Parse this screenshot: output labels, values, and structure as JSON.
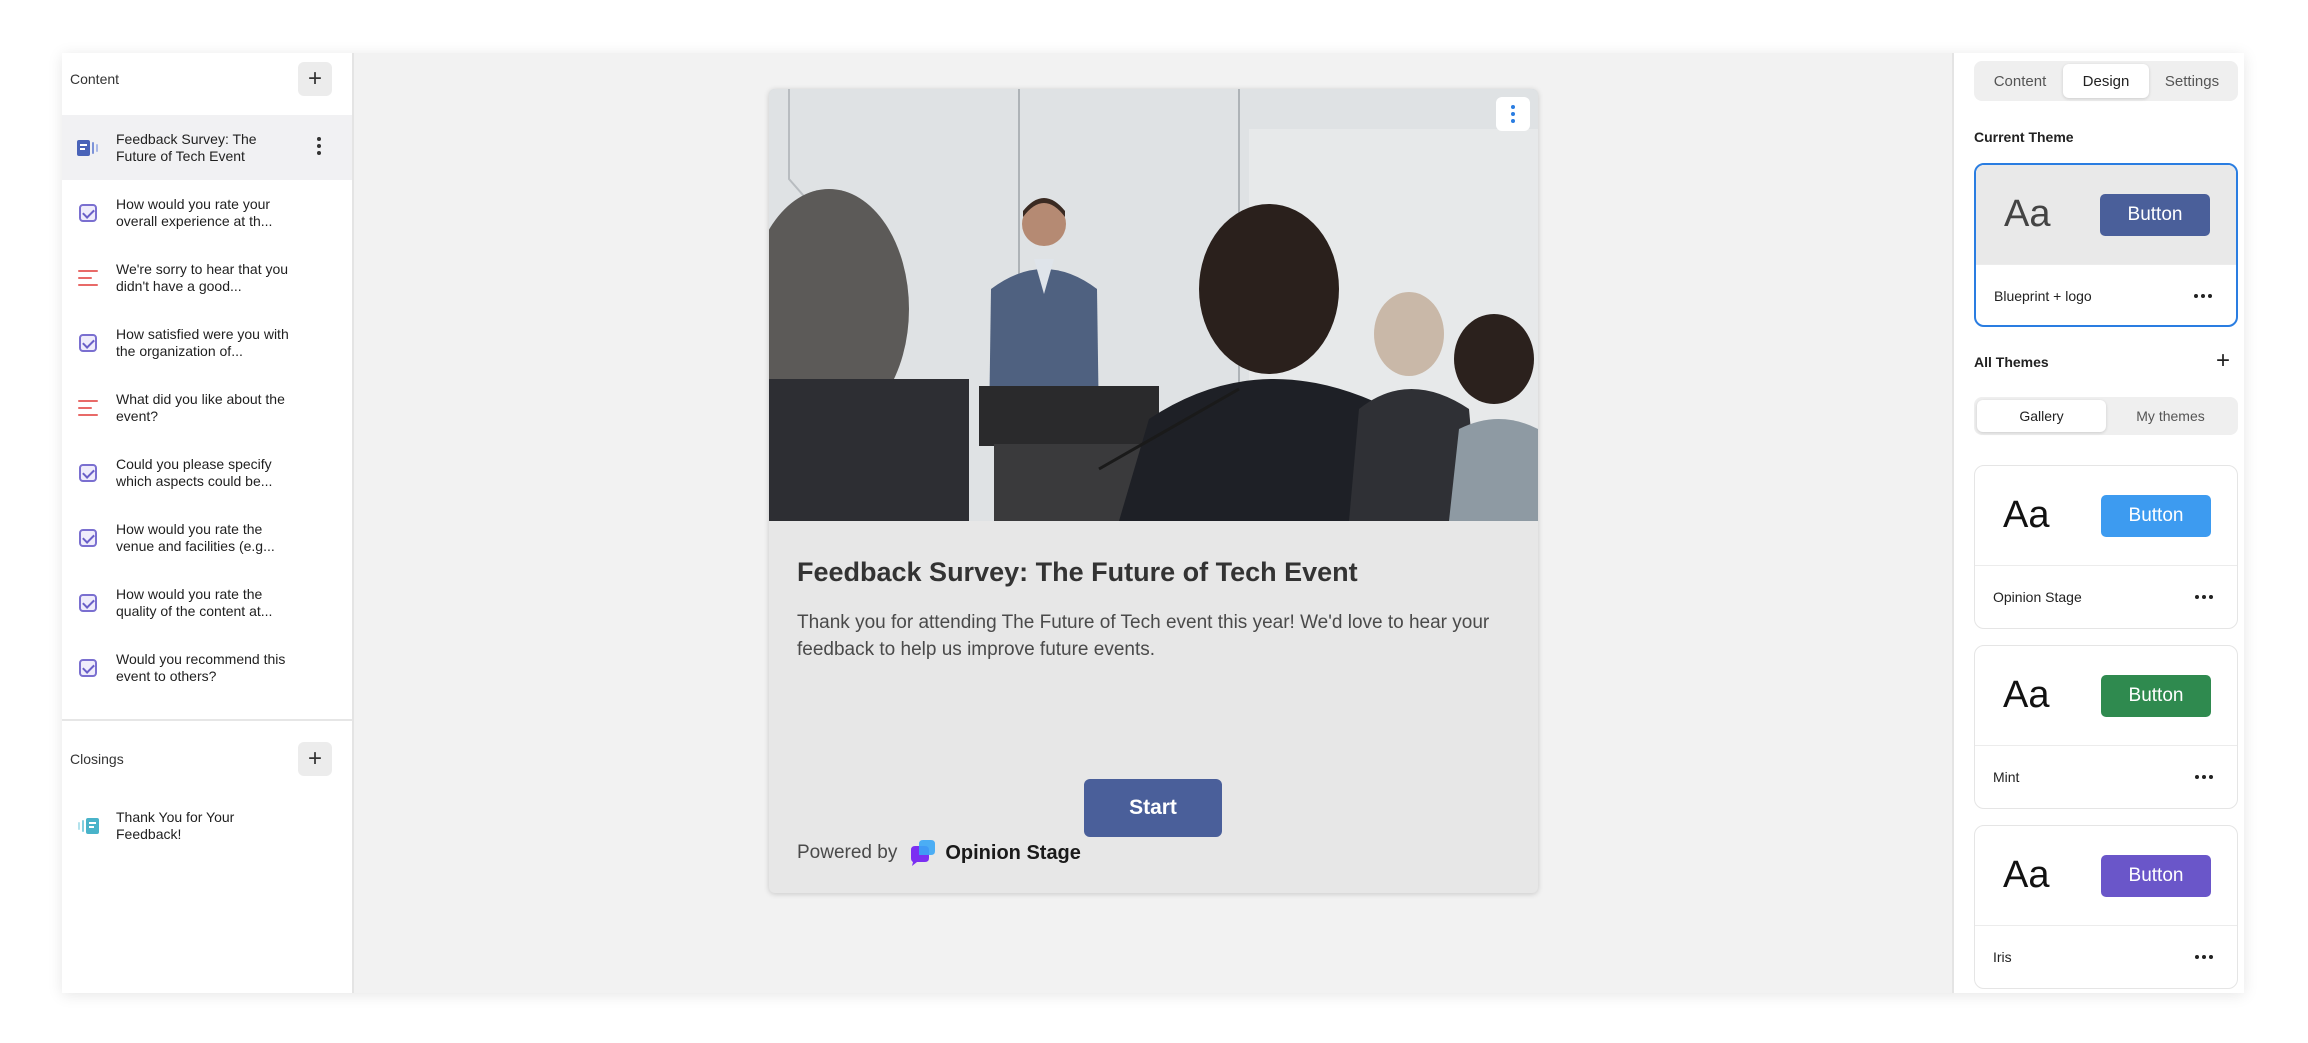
{
  "left_panel": {
    "content_title": "Content",
    "items": [
      {
        "label": "Feedback Survey: The Future of Tech Event",
        "icon": "intro-icon",
        "active": true
      },
      {
        "label": "How would you rate your overall experience at th...",
        "icon": "checkbox-icon"
      },
      {
        "label": "We're sorry to hear that you didn't have a good...",
        "icon": "text-lines-icon"
      },
      {
        "label": "How satisfied were you with the organization of...",
        "icon": "checkbox-icon"
      },
      {
        "label": "What did you like about the event?",
        "icon": "text-lines-icon"
      },
      {
        "label": "Could you please specify which aspects could be...",
        "icon": "checkbox-icon"
      },
      {
        "label": "How would you rate the venue and facilities (e.g...",
        "icon": "checkbox-icon"
      },
      {
        "label": "How would you rate the quality of the content at...",
        "icon": "checkbox-icon"
      },
      {
        "label": "Would you recommend this event to others?",
        "icon": "checkbox-icon"
      }
    ],
    "closings_title": "Closings",
    "closing_item": {
      "label": "Thank You for Your Feedback!",
      "icon": "closing-icon"
    }
  },
  "card": {
    "title": "Feedback Survey: The Future of Tech Event",
    "description": "Thank you for attending The Future of Tech event this year! We'd love to hear your feedback to help us improve future events.",
    "start_label": "Start",
    "powered_by": "Powered by",
    "brand": "Opinion Stage"
  },
  "right_panel": {
    "tabs": [
      "Content",
      "Design",
      "Settings"
    ],
    "active_tab": "Design",
    "current_theme_label": "Current Theme",
    "all_themes_label": "All Themes",
    "segments": [
      "Gallery",
      "My themes"
    ],
    "current_theme": {
      "sample": "Aa",
      "button": "Button",
      "name": "Blueprint + logo",
      "color": "#4a5f9a"
    },
    "themes": [
      {
        "sample": "Aa",
        "button": "Button",
        "name": "Opinion Stage",
        "color": "#3d9bf0"
      },
      {
        "sample": "Aa",
        "button": "Button",
        "name": "Mint",
        "color": "#2f8a4f"
      },
      {
        "sample": "Aa",
        "button": "Button",
        "name": "Iris",
        "color": "#6a56c9"
      }
    ]
  },
  "colors": {
    "accent": "#2a7de1",
    "start_button": "#4a5f9a"
  }
}
